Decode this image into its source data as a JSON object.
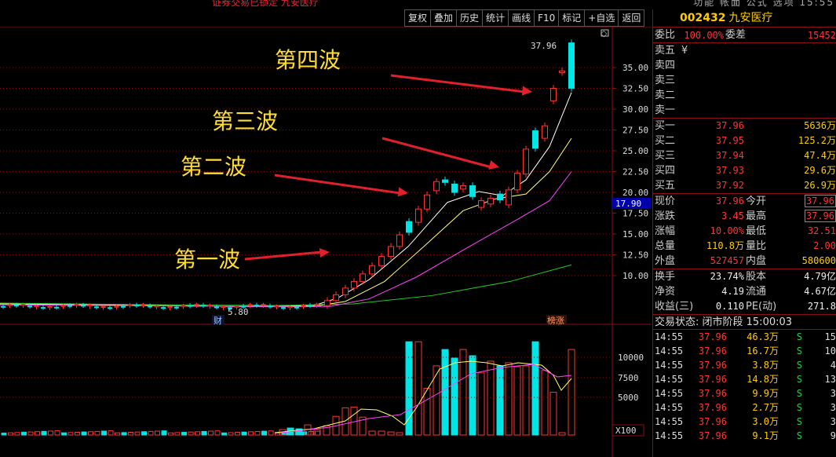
{
  "top": {
    "warning": "证券交易已锁定 九安医疗",
    "menu": "功能 帐面 公式 选项 15:55"
  },
  "toolbar": {
    "buttons": [
      "复权",
      "叠加",
      "历史",
      "统计",
      "画线",
      "F10",
      "标记",
      "+自选",
      "返回"
    ]
  },
  "stock": {
    "code": "002432",
    "name": "九安医疗"
  },
  "ratio": {
    "label1": "委比",
    "value1": "100.00%",
    "label2": "委差",
    "value2": "15452"
  },
  "sell": [
    {
      "label": "卖五",
      "price": "¥",
      "vol": ""
    },
    {
      "label": "卖四",
      "price": "",
      "vol": ""
    },
    {
      "label": "卖三",
      "price": "",
      "vol": ""
    },
    {
      "label": "卖二",
      "price": "",
      "vol": ""
    },
    {
      "label": "卖一",
      "price": "",
      "vol": ""
    }
  ],
  "buy": [
    {
      "label": "买一",
      "price": "37.96",
      "vol": "5636万"
    },
    {
      "label": "买二",
      "price": "37.95",
      "vol": "125.2万"
    },
    {
      "label": "买三",
      "price": "37.94",
      "vol": "47.4万"
    },
    {
      "label": "买四",
      "price": "37.93",
      "vol": "29.6万"
    },
    {
      "label": "买五",
      "price": "37.92",
      "vol": "26.9万"
    }
  ],
  "stats": [
    {
      "l1": "现价",
      "v1": "37.96",
      "c1": "red",
      "l2": "今开",
      "v2": "37.96",
      "c2": "red boxed"
    },
    {
      "l1": "涨跌",
      "v1": "3.45",
      "c1": "red",
      "l2": "最高",
      "v2": "37.96",
      "c2": "red boxed"
    },
    {
      "l1": "涨幅",
      "v1": "10.00%",
      "c1": "red",
      "l2": "最低",
      "v2": "32.51",
      "c2": "red"
    },
    {
      "l1": "总量",
      "v1": "110.8万",
      "c1": "yel",
      "l2": "量比",
      "v2": "2.00",
      "c2": "red"
    },
    {
      "l1": "外盘",
      "v1": "527457",
      "c1": "red",
      "l2": "内盘",
      "v2": "580600",
      "c2": "yel"
    }
  ],
  "stats2": [
    {
      "l1": "换手",
      "v1": "23.74%",
      "c1": "wht",
      "l2": "股本",
      "v2": "4.79亿",
      "c2": "wht"
    },
    {
      "l1": "净资",
      "v1": "4.19",
      "c1": "wht",
      "l2": "流通",
      "v2": "4.67亿",
      "c2": "wht"
    },
    {
      "l1": "收益(三)",
      "v1": "0.110",
      "c1": "wht",
      "l2": "PE(动)",
      "v2": "271.8",
      "c2": "wht"
    }
  ],
  "trade_status": "交易状态: 闭市阶段 15:00:03",
  "ticks": [
    {
      "t": "14:55",
      "p": "37.96",
      "v": "46.3万",
      "d": "S",
      "n": "15"
    },
    {
      "t": "14:55",
      "p": "37.96",
      "v": "16.7万",
      "d": "S",
      "n": "10"
    },
    {
      "t": "14:55",
      "p": "37.96",
      "v": "3.8万",
      "d": "S",
      "n": "4"
    },
    {
      "t": "14:55",
      "p": "37.96",
      "v": "14.8万",
      "d": "S",
      "n": "13"
    },
    {
      "t": "14:55",
      "p": "37.96",
      "v": "9.9万",
      "d": "S",
      "n": "3"
    },
    {
      "t": "14:55",
      "p": "37.96",
      "v": "2.7万",
      "d": "S",
      "n": "3"
    },
    {
      "t": "14:55",
      "p": "37.96",
      "v": "3.0万",
      "d": "S",
      "n": "3"
    },
    {
      "t": "14:55",
      "p": "37.96",
      "v": "9.1万",
      "d": "S",
      "n": "9"
    }
  ],
  "chart": {
    "price_ticks": [
      "35.00",
      "32.50",
      "30.00",
      "27.50",
      "25.00",
      "22.50",
      "20.00",
      "17.50",
      "15.00",
      "12.50",
      "10.00"
    ],
    "current_price_label": "17.90",
    "high_label": "37.96",
    "low_label": "5.80",
    "vol_ticks": [
      "10000",
      "7500",
      "5000"
    ],
    "vol_unit": "X100",
    "marker_cai": "财",
    "marker_bang": "榜涨",
    "annotations": [
      "第一波",
      "第二波",
      "第三波",
      "第四波"
    ]
  },
  "colors": {
    "up": "#ff3333",
    "down": "#00e5e5",
    "ma5": "#ffffff",
    "ma10": "#ffff66",
    "ma20": "#ff44ff",
    "ma60": "#22cc22",
    "grid": "#7a1010"
  }
}
